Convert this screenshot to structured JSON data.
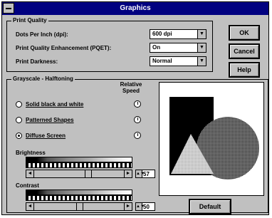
{
  "window": {
    "title": "Graphics"
  },
  "print_quality": {
    "group_label": "Print Quality",
    "dpi_label": "Dots Per Inch (dpi):",
    "dpi_value": "600 dpi",
    "pqet_label": "Print Quality Enhancement (PQET):",
    "pqet_value": "On",
    "darkness_label": "Print Darkness:",
    "darkness_value": "Normal"
  },
  "buttons": {
    "ok": "OK",
    "cancel": "Cancel",
    "help": "Help",
    "default": "Default"
  },
  "grayscale": {
    "group_label": "Grayscale - Halftoning",
    "speed_label": "Relative Speed",
    "options": [
      "Solid black and white",
      "Patterned Shapes",
      "Diffuse Screen"
    ],
    "selected": "Diffuse Screen"
  },
  "brightness": {
    "label": "Brightness",
    "value": "57"
  },
  "contrast": {
    "label": "Contrast",
    "value": "50"
  },
  "icons": {
    "dropdown": "▼",
    "left": "◄",
    "right": "►",
    "spin": "▲▼"
  }
}
